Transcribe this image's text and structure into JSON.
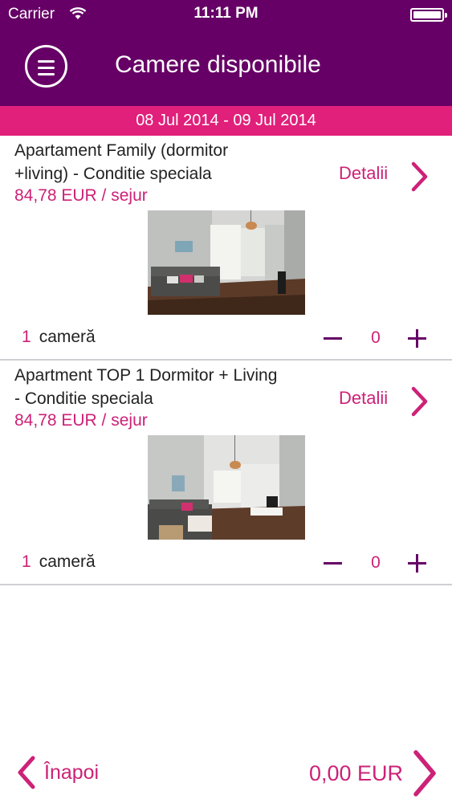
{
  "status_bar": {
    "carrier": "Carrier",
    "time": "11:11 PM"
  },
  "header": {
    "title": "Camere disponibile",
    "menu_icon": "hamburger-menu-icon"
  },
  "date_range": "08 Jul 2014 - 09 Jul 2014",
  "rooms": [
    {
      "name": "Apartament Family (dormitor +living) - Conditie speciala",
      "price": "84,78 EUR / sejur",
      "details_label": "Detalii",
      "room_count": "1",
      "room_unit": "cameră",
      "quantity": "0"
    },
    {
      "name": "Apartment TOP 1 Dormitor + Living - Conditie speciala",
      "price": "84,78 EUR / sejur",
      "details_label": "Detalii",
      "room_count": "1",
      "room_unit": "cameră",
      "quantity": "0"
    }
  ],
  "footer": {
    "back_label": "Înapoi",
    "total": "0,00 EUR"
  },
  "colors": {
    "header": "#660066",
    "accent": "#e0207a",
    "text_accent": "#cc2277"
  }
}
